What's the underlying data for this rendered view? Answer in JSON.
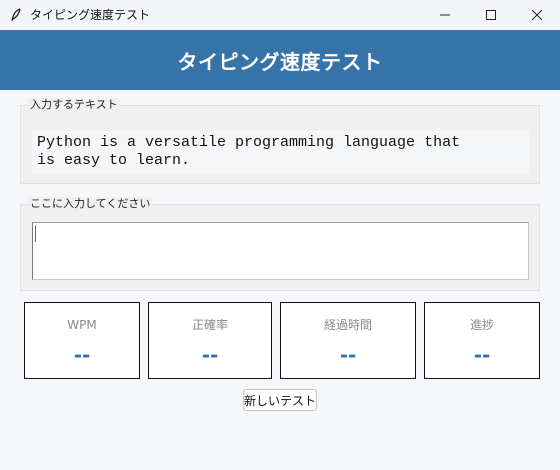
{
  "window": {
    "title": "タイピング速度テスト",
    "icon": "feather-icon",
    "controls": [
      "minimize-icon",
      "maximize-icon",
      "close-icon"
    ]
  },
  "header": {
    "title": "タイピング速度テスト"
  },
  "target": {
    "label": "入力するテキスト",
    "text": "Python is a versatile programming language that\nis easy to learn."
  },
  "input": {
    "label": "ここに入力してください",
    "value": ""
  },
  "stats": [
    {
      "label": "WPM",
      "value": "--"
    },
    {
      "label": "正確率",
      "value": "--"
    },
    {
      "label": "経過時間",
      "value": "--"
    },
    {
      "label": "進捗",
      "value": "--"
    }
  ],
  "actions": {
    "new_test_label": "新しいテスト"
  },
  "colors": {
    "accent": "#3573a8",
    "header_text": "#ffffff",
    "background": "#f5f7fb"
  }
}
